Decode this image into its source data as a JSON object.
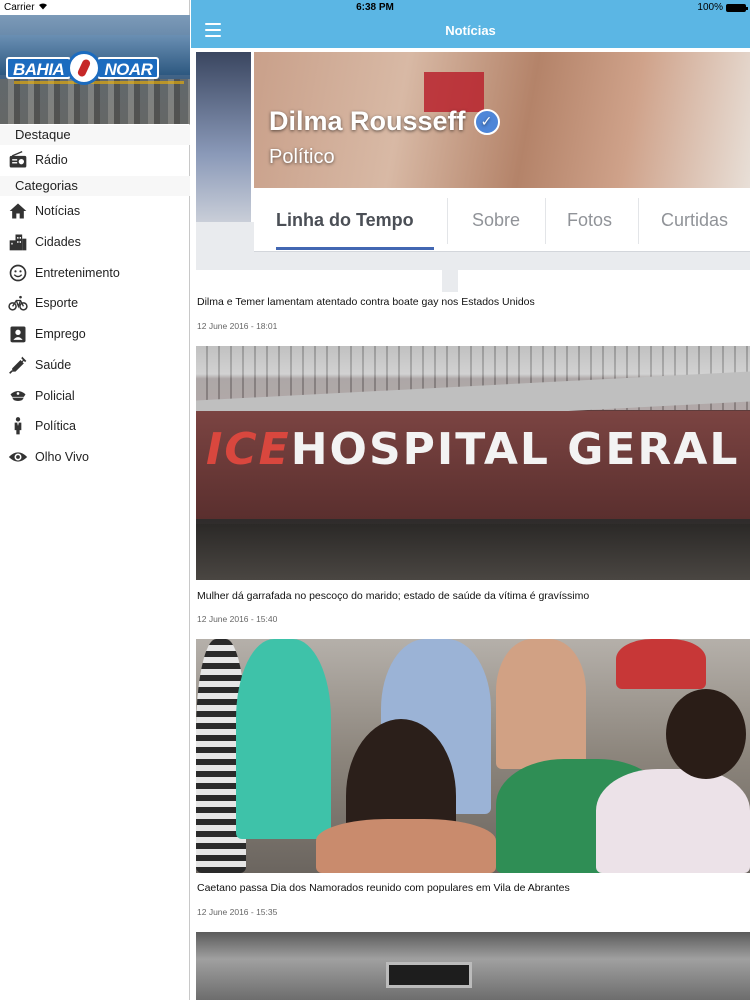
{
  "status_bar": {
    "carrier": "Carrier",
    "time": "6:38 PM",
    "battery": "100%"
  },
  "sidebar": {
    "logo": {
      "text_left": "BAHIA",
      "text_right": "NOAR"
    },
    "sections": [
      {
        "header": "Destaque",
        "items": [
          {
            "label": "Rádio",
            "icon": "radio-icon"
          }
        ]
      },
      {
        "header": "Categorias",
        "items": [
          {
            "label": "Notícias",
            "icon": "home-icon"
          },
          {
            "label": "Cidades",
            "icon": "city-icon"
          },
          {
            "label": "Entretenimento",
            "icon": "smiley-icon"
          },
          {
            "label": "Esporte",
            "icon": "bicycle-icon"
          },
          {
            "label": "Emprego",
            "icon": "badge-icon"
          },
          {
            "label": "Saúde",
            "icon": "syringe-icon"
          },
          {
            "label": "Policial",
            "icon": "police-cap-icon"
          },
          {
            "label": "Política",
            "icon": "politician-icon"
          },
          {
            "label": "Olho Vivo",
            "icon": "eye-icon"
          }
        ]
      }
    ]
  },
  "navbar": {
    "title": "Notícias",
    "menu_icon": "hamburger-icon"
  },
  "articles": [
    {
      "headline": "Dilma e Temer lamentam atentado contra boate gay nos Estados Unidos",
      "date": "12 June 2016 - 18:01",
      "image": {
        "name": "Dilma Rousseff",
        "role": "Político",
        "tabs": [
          "Linha do Tempo",
          "Sobre",
          "Fotos",
          "Curtidas"
        ]
      }
    },
    {
      "headline": "Mulher dá garrafada no pescoço do marido; estado de saúde da vítima é gravíssimo",
      "date": "12 June 2016 - 15:40",
      "image": {
        "sign_prefix": "ICE",
        "sign": "HOSPITAL GERAL D"
      }
    },
    {
      "headline": "Caetano passa Dia dos Namorados reunido com populares em Vila de Abrantes",
      "date": "12 June 2016 - 15:35"
    },
    {}
  ],
  "colors": {
    "navbar": "#5bb6e4",
    "sidebar_header_bg": "#f7f7f7",
    "fb_blue": "#4267b2"
  }
}
